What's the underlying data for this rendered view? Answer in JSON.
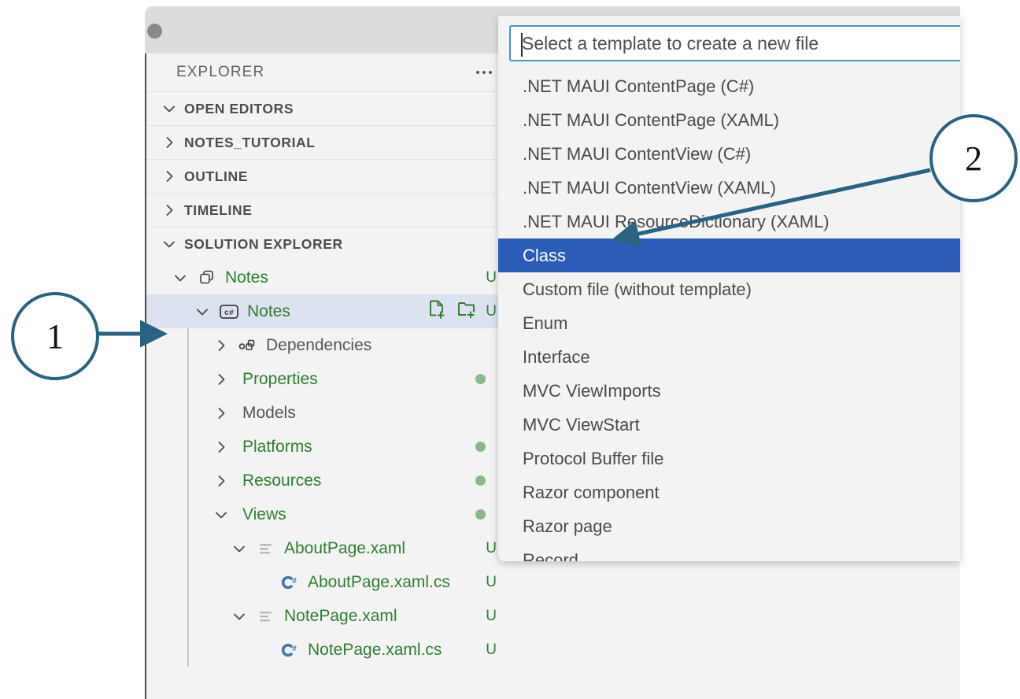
{
  "window": {
    "dot_icon": "window-dot"
  },
  "explorer": {
    "title": "EXPLORER",
    "more_icon": "ellipsis-icon",
    "sections": [
      {
        "label": "OPEN EDITORS",
        "expanded": true,
        "icon": "chevron-down-icon"
      },
      {
        "label": "NOTES_TUTORIAL",
        "expanded": false,
        "icon": "chevron-right-icon"
      },
      {
        "label": "OUTLINE",
        "expanded": false,
        "icon": "chevron-right-icon"
      },
      {
        "label": "TIMELINE",
        "expanded": false,
        "icon": "chevron-right-icon"
      },
      {
        "label": "SOLUTION EXPLORER",
        "expanded": true,
        "icon": "chevron-down-icon"
      }
    ]
  },
  "solution_tree": [
    {
      "label": "Notes",
      "indent": 1,
      "twisty": "chevron-down-icon",
      "icon": "solution-icon",
      "color": "green",
      "badge": "U",
      "badge_type": "text"
    },
    {
      "label": "Notes",
      "indent": 2,
      "twisty": "chevron-down-icon",
      "icon": "csharp-project-icon",
      "color": "green",
      "badge": "U",
      "badge_type": "text",
      "selected": true,
      "actions": [
        "new-file-icon",
        "new-folder-icon"
      ]
    },
    {
      "label": "Dependencies",
      "indent": 3,
      "twisty": "chevron-right-icon",
      "icon": "dependencies-icon",
      "color": "gray",
      "badge": "",
      "badge_type": "none"
    },
    {
      "label": "Properties",
      "indent": 3,
      "twisty": "chevron-right-icon",
      "icon": "none",
      "color": "green",
      "badge": "",
      "badge_type": "dot"
    },
    {
      "label": "Models",
      "indent": 3,
      "twisty": "chevron-right-icon",
      "icon": "none",
      "color": "gray",
      "badge": "",
      "badge_type": "none"
    },
    {
      "label": "Platforms",
      "indent": 3,
      "twisty": "chevron-right-icon",
      "icon": "none",
      "color": "green",
      "badge": "",
      "badge_type": "dot"
    },
    {
      "label": "Resources",
      "indent": 3,
      "twisty": "chevron-right-icon",
      "icon": "none",
      "color": "green",
      "badge": "",
      "badge_type": "dot"
    },
    {
      "label": "Views",
      "indent": 3,
      "twisty": "chevron-down-icon",
      "icon": "none",
      "color": "green",
      "badge": "",
      "badge_type": "dot"
    },
    {
      "label": "AboutPage.xaml",
      "indent": 4,
      "twisty": "chevron-down-icon",
      "icon": "xaml-icon",
      "color": "green",
      "badge": "U",
      "badge_type": "text"
    },
    {
      "label": "AboutPage.xaml.cs",
      "indent": 5,
      "twisty": "none",
      "icon": "csharp-file-icon",
      "color": "green",
      "badge": "U",
      "badge_type": "text"
    },
    {
      "label": "NotePage.xaml",
      "indent": 4,
      "twisty": "chevron-down-icon",
      "icon": "xaml-icon",
      "color": "green",
      "badge": "U",
      "badge_type": "text"
    },
    {
      "label": "NotePage.xaml.cs",
      "indent": 5,
      "twisty": "none",
      "icon": "csharp-file-icon",
      "color": "green",
      "badge": "U",
      "badge_type": "text"
    }
  ],
  "quickpick": {
    "placeholder": "Select a template to create a new file",
    "value": "",
    "selected_index": 5,
    "items": [
      ".NET MAUI ContentPage (C#)",
      ".NET MAUI ContentPage (XAML)",
      ".NET MAUI ContentView (C#)",
      ".NET MAUI ContentView (XAML)",
      ".NET MAUI ResourceDictionary (XAML)",
      "Class",
      "Custom file (without template)",
      "Enum",
      "Interface",
      "MVC ViewImports",
      "MVC ViewStart",
      "Protocol Buffer file",
      "Razor component",
      "Razor page",
      "Record"
    ]
  },
  "callouts": [
    {
      "number": "1"
    },
    {
      "number": "2"
    }
  ],
  "colors": {
    "accent_selection": "#2b5cb8",
    "tree_green": "#2f7d32",
    "callout_stroke": "#2a6382",
    "row_selected": "#dde2f0",
    "input_border": "#4a90d9"
  }
}
